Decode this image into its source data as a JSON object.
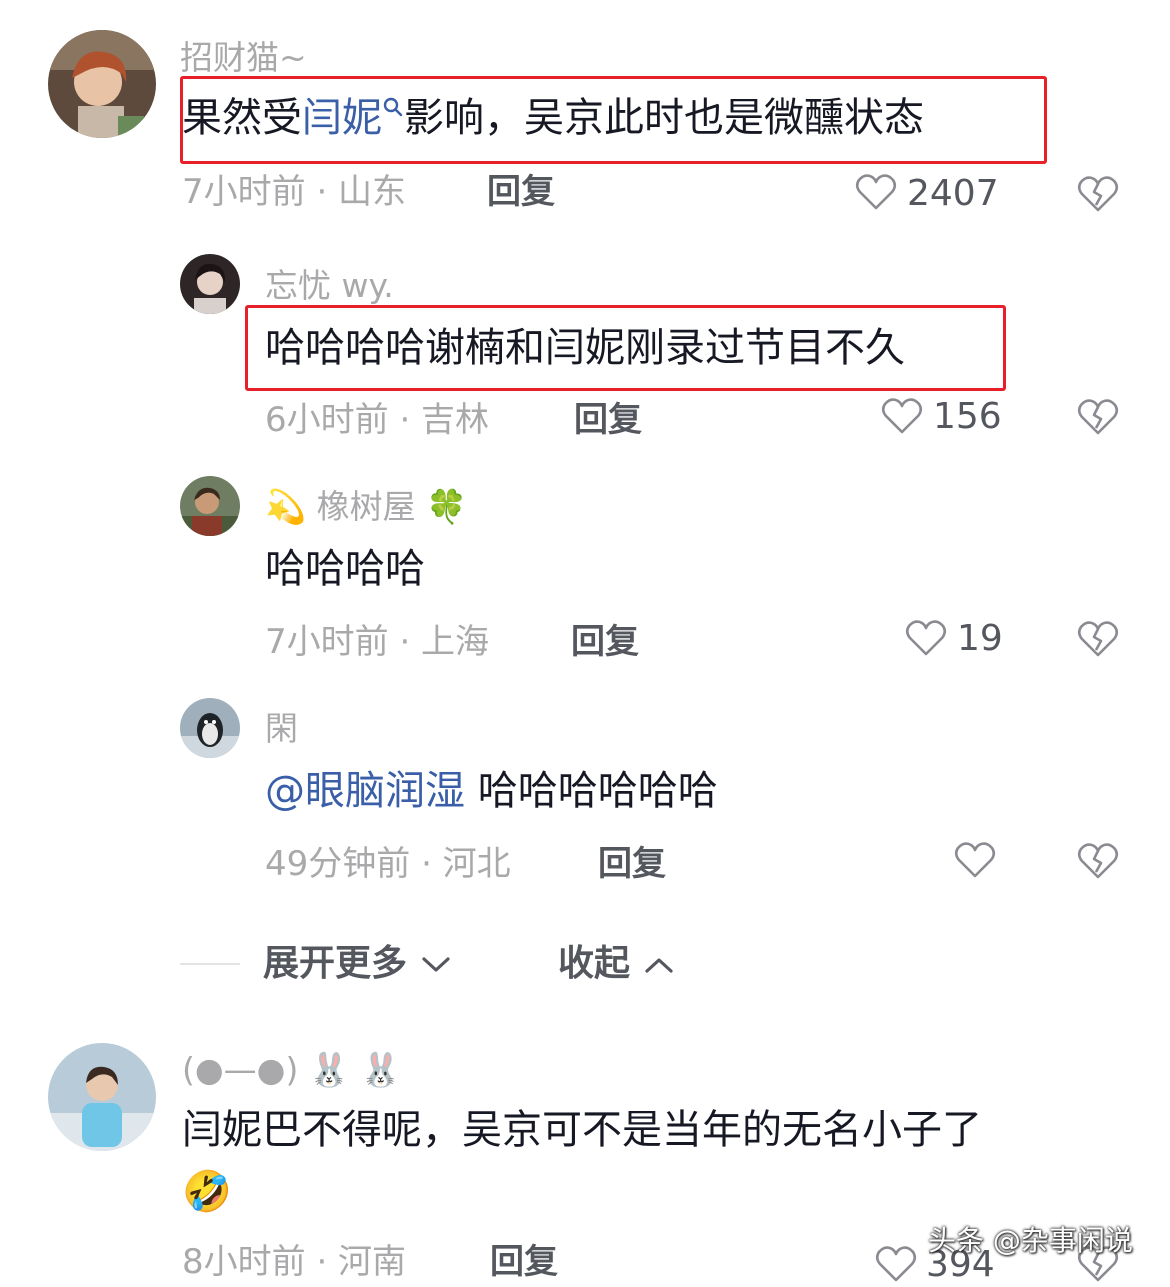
{
  "comments": [
    {
      "username": "招财猫~",
      "content_pre": "果然受",
      "content_link": "闫妮",
      "content_post": "影响，吴京此时也是微醺状态",
      "meta": "7小时前 · 山东",
      "reply_label": "回复",
      "likes": "2407",
      "avatar_color": "#7a5a45"
    },
    {
      "username": "忘忧 wy.",
      "content": "哈哈哈哈谢楠和闫妮刚录过节目不久",
      "meta": "6小时前 · 吉林",
      "reply_label": "回复",
      "likes": "156",
      "avatar_color": "#3a3030"
    },
    {
      "username_prefix_emoji": "💫",
      "username": "橡树屋",
      "username_suffix_emoji": "🍀",
      "content": "哈哈哈哈",
      "meta": "7小时前 · 上海",
      "reply_label": "回复",
      "likes": "19",
      "avatar_color": "#5a6b4a"
    },
    {
      "username": "閑",
      "content_mention": "@眼脑润湿",
      "content": "哈哈哈哈哈哈",
      "meta": "49分钟前 · 河北",
      "reply_label": "回复",
      "likes": "",
      "avatar_color": "#7d8e9a"
    },
    {
      "username": "(●—●)",
      "username_suffix_emoji": "🐰 🐰",
      "content": "闫妮巴不得呢，吴京可不是当年的无名小子了",
      "content_emoji": "🤣",
      "meta": "8小时前 · 河南",
      "reply_label": "回复",
      "likes": "394",
      "avatar_color": "#a9c5d8"
    }
  ],
  "thread_controls": {
    "expand_more_label": "展开更多",
    "collapse_label": "收起"
  },
  "watermark": "头条 @杂事闲说",
  "colors": {
    "highlight_border": "#e8202a",
    "link": "#3a5fa8",
    "primary_text": "#161823",
    "secondary_text": "#a9a9ab"
  }
}
